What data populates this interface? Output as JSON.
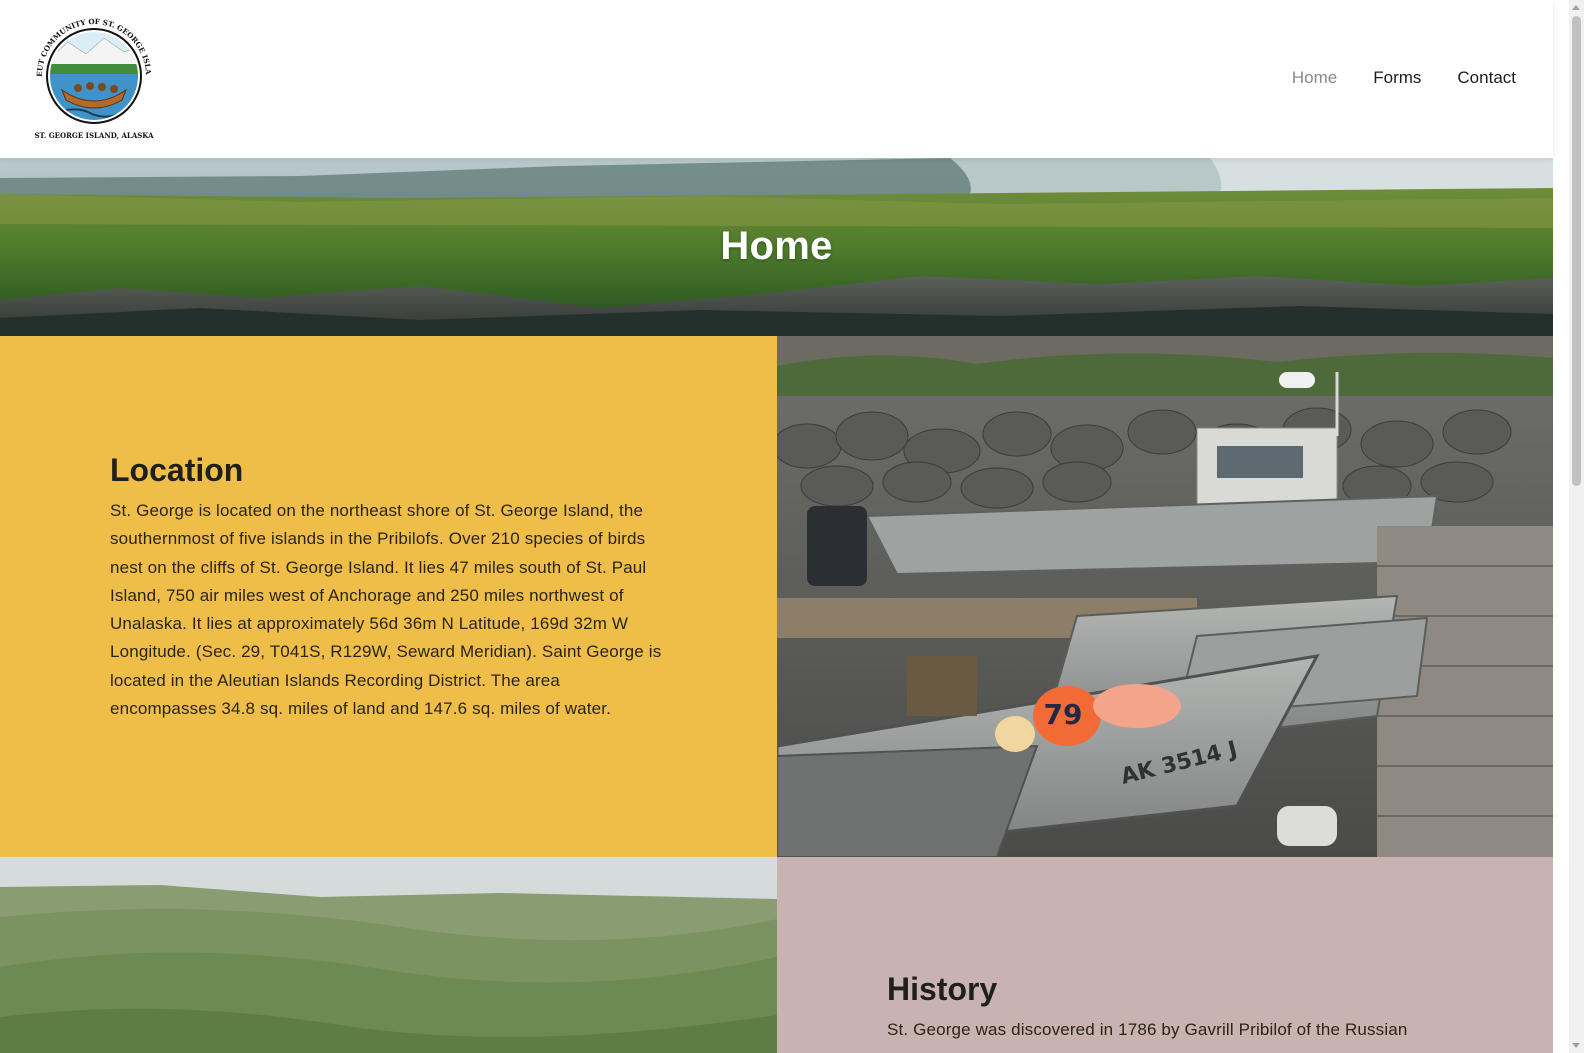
{
  "header": {
    "logo_alt": "Aleut Community of St. George Island",
    "logo_text_top": "ALEUT COMMUNITY OF ST. GEORGE ISLAND",
    "logo_text_bottom": "ST. GEORGE ISLAND, ALASKA",
    "nav": [
      {
        "label": "Home",
        "active": true
      },
      {
        "label": "Forms",
        "active": false
      },
      {
        "label": "Contact",
        "active": false
      }
    ]
  },
  "hero": {
    "title": "Home"
  },
  "location": {
    "heading": "Location",
    "body": "St. George is located on the northeast shore of St. George Island, the southernmost of five islands in the Pribilofs. Over 210 species of birds nest on the cliffs of St. George Island. It lies 47 miles south of St. Paul Island, 750 air miles west of Anchorage and 250 miles northwest of Unalaska. It lies at approximately 56d 36m N Latitude, 169d 32m W Longitude. (Sec. 29, T041S, R129W, Seward Meridian). Saint George is located in the Aleutian Islands Recording District. The area encompasses 34.8 sq. miles of land and 147.6 sq. miles of water.",
    "boat_label": "AK 3514 J",
    "buoy_label": "79"
  },
  "history": {
    "heading": "History",
    "body": "St. George was discovered in 1786 by Gavrill Pribilof of the Russian"
  },
  "colors": {
    "location_bg": "#efbe48",
    "history_bg": "#c9b3b1",
    "nav_active": "#8a8a8a"
  }
}
